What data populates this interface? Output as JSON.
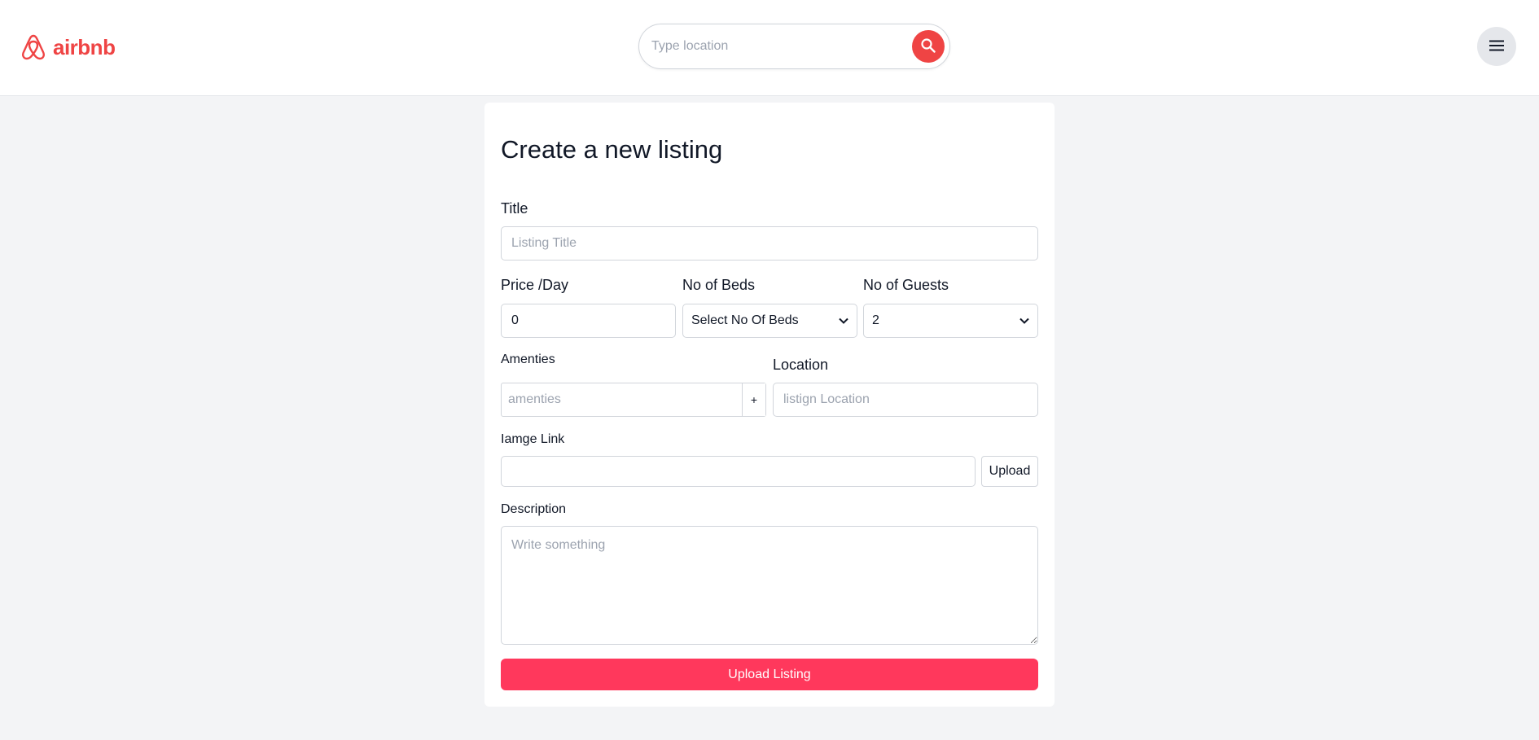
{
  "header": {
    "brand": "airbnb",
    "search": {
      "placeholder": "Type location",
      "value": ""
    }
  },
  "form": {
    "title": "Create a new listing",
    "fields": {
      "title": {
        "label": "Title",
        "placeholder": "Listing Title",
        "value": ""
      },
      "price": {
        "label": "Price /Day",
        "value": "0"
      },
      "beds": {
        "label": "No of Beds",
        "selected": "Select No Of Beds"
      },
      "guests": {
        "label": "No of Guests",
        "selected": "2"
      },
      "amenities": {
        "label": "Amenties",
        "placeholder": "amenties",
        "add_label": "+"
      },
      "location": {
        "label": "Location",
        "placeholder": "listign Location"
      },
      "image": {
        "label": "Iamge Link",
        "value": "",
        "upload_label": "Upload"
      },
      "description": {
        "label": "Description",
        "placeholder": "Write something"
      }
    },
    "submit_label": "Upload Listing"
  },
  "colors": {
    "brand": "#ef4444",
    "submit": "#ff385c",
    "page_bg": "#f3f4f6"
  },
  "icons": {
    "logo": "airbnb-logo-icon",
    "search": "search-icon",
    "menu": "hamburger-menu-icon",
    "select": "chevron-down-icon"
  }
}
